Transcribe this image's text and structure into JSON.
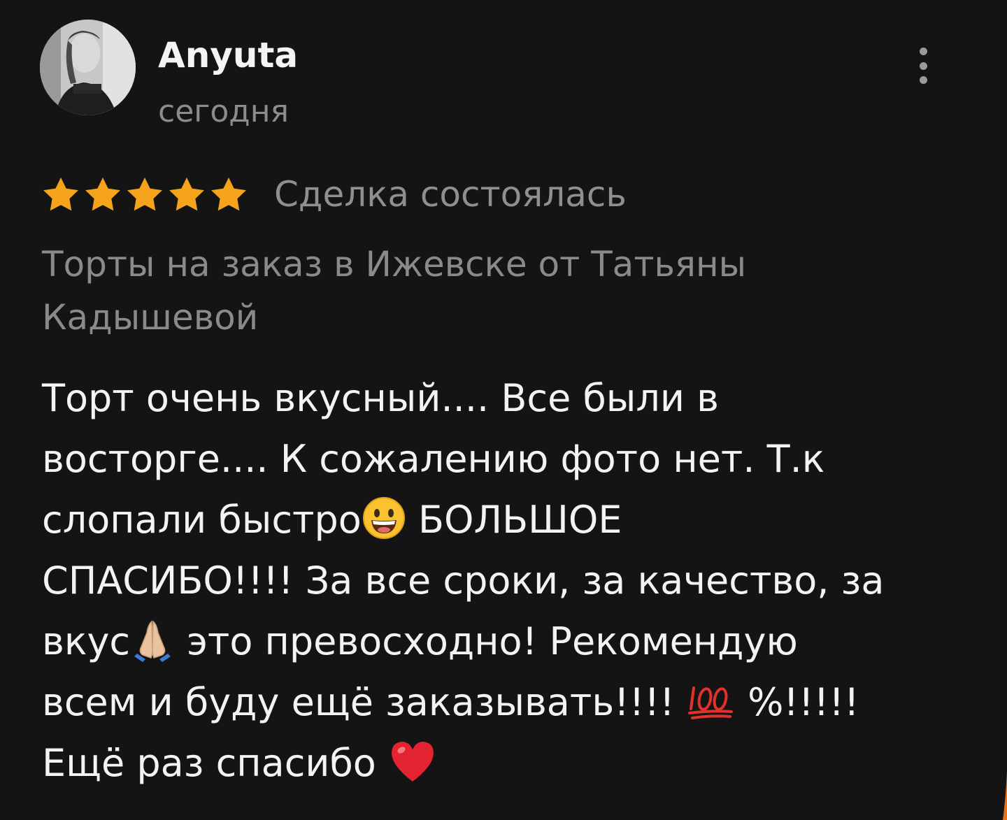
{
  "review": {
    "author": "Anyuta",
    "date": "сегодня",
    "rating": 5,
    "rating_max": 5,
    "deal_status": "Сделка состоялась",
    "shop": "Торты на заказ в Ижевске от Татьяны Кадышевой",
    "text_lines": {
      "l1": "Торт очень вкусный.... Все были в",
      "l2": "восторге.... К сожалению фото нет. Т.к",
      "l3a": "слопали быстро",
      "l3b": " БОЛЬШОЕ",
      "l4": "СПАСИБО!!!! За все сроки, за качество, за",
      "l5a": "вкус",
      "l5b": " это превосходно! Рекомендую",
      "l6a": "всем и буду ещё заказывать!!!! ",
      "l6b": " %!!!!!",
      "l7a": "Ещё раз спасибо "
    }
  },
  "icons": {
    "menu": "more-vertical-icon",
    "star": "star-filled-icon",
    "emoji_grin": "grinning-face-emoji",
    "emoji_pray": "folded-hands-emoji",
    "emoji_hundred": "hundred-points-emoji",
    "emoji_heart": "red-heart-emoji"
  },
  "colors": {
    "background": "#141414",
    "star": "#f5a31a",
    "text_primary": "#f3f3f3",
    "text_secondary": "#8c8c8c",
    "accent_edge": "#e8731a"
  }
}
